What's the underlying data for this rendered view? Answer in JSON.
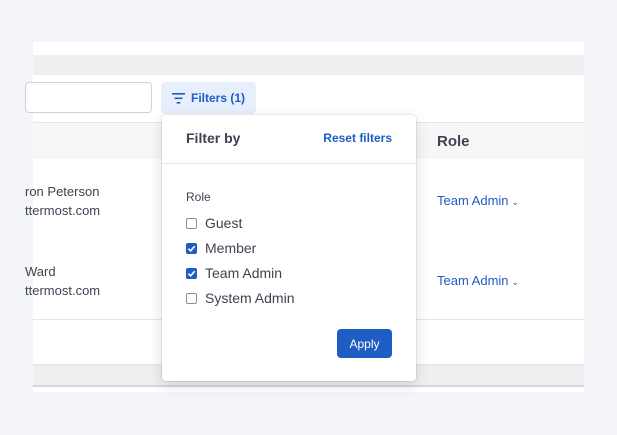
{
  "toolbar": {
    "filters_label": "Filters (1)"
  },
  "table": {
    "role_header": "Role",
    "rows": [
      {
        "name": "ron Peterson",
        "email": "ttermost.com",
        "role": "Team Admin"
      },
      {
        "name": "Ward",
        "email": "ttermost.com",
        "role": "Team Admin"
      }
    ]
  },
  "filter_dropdown": {
    "title": "Filter by",
    "reset_label": "Reset filters",
    "section_label": "Role",
    "options": [
      {
        "label": "Guest",
        "checked": false
      },
      {
        "label": "Member",
        "checked": true
      },
      {
        "label": "Team Admin",
        "checked": true
      },
      {
        "label": "System Admin",
        "checked": false
      }
    ],
    "apply_label": "Apply"
  },
  "icons": {
    "filter": "filter-lines-icon",
    "chevron": "chevron-down-icon",
    "check": "checkmark-icon"
  },
  "colors": {
    "accent": "#1e5dc3",
    "accent_light": "#e6effb",
    "text": "#3f4350",
    "background": "#f4f5f8"
  }
}
